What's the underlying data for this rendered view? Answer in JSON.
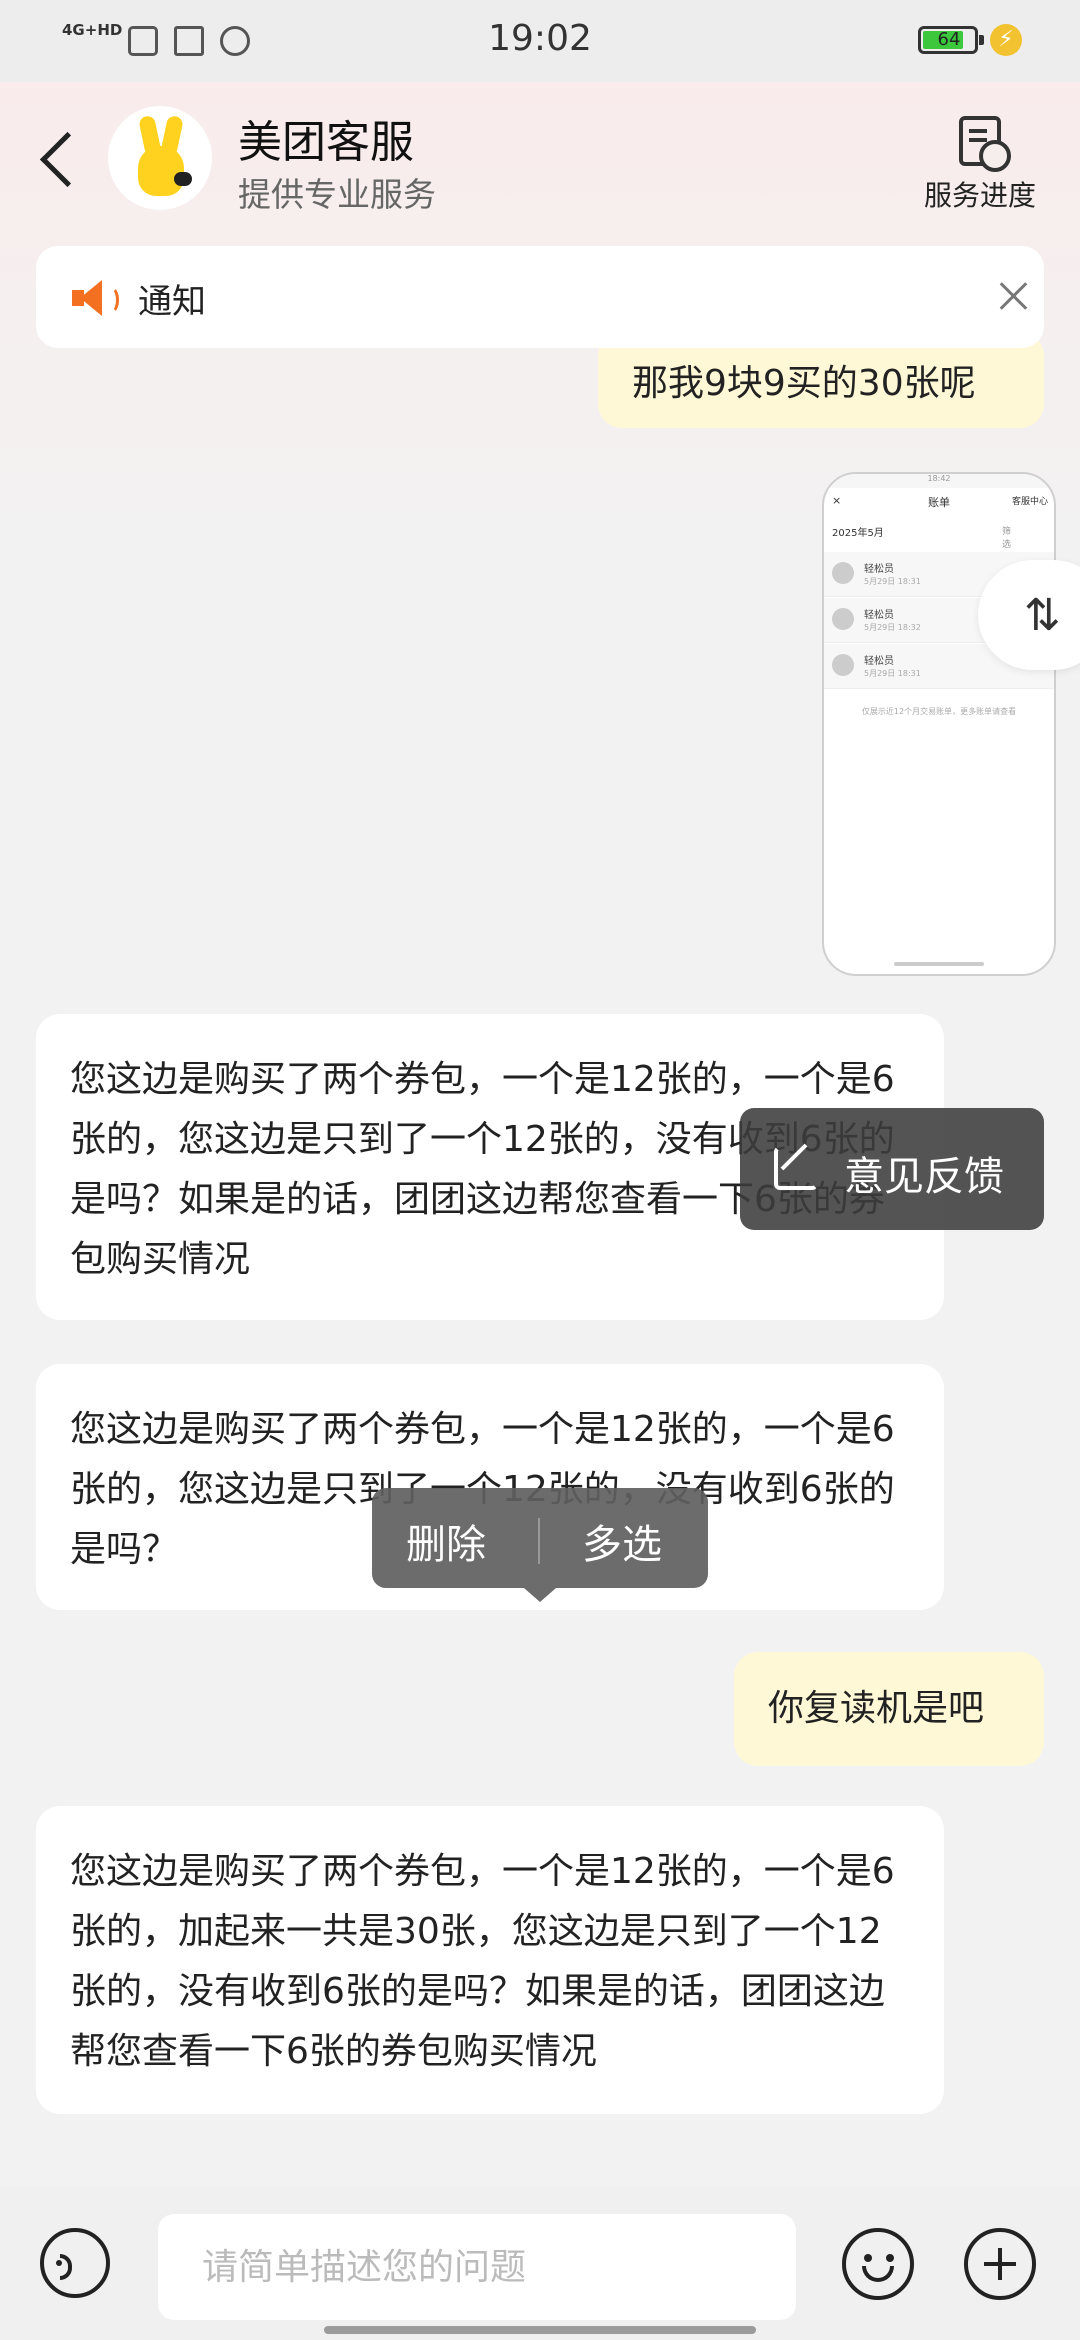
{
  "status_bar": {
    "network": "4G+HD",
    "time": "19:02",
    "battery": "64",
    "icons": [
      "sim-icon",
      "book-icon",
      "wechat-icon",
      "charging-icon"
    ]
  },
  "header": {
    "title": "美团客服",
    "subtitle": "提供专业服务",
    "progress_label": "服务进度"
  },
  "notice": {
    "label": "通知"
  },
  "messages": [
    {
      "role": "user",
      "text": "那我9块9买的30张呢"
    },
    {
      "role": "agent",
      "text": "您这边是购买了两个券包，一个是12张的，一个是6张的，您这边是只到了一个12张的，没有收到6张的是吗？如果是的话，团团这边帮您查看一下6张的券包购买情况"
    },
    {
      "role": "agent",
      "text": "您这边是购买了两个券包，一个是12张的，一个是6张的，您这边是只到了一个12张的，没有收到6张的是吗？"
    },
    {
      "role": "user",
      "text": "你复读机是吧"
    },
    {
      "role": "agent",
      "text": "您这边是购买了两个券包，一个是12张的，一个是6张的，加起来一共是30张，您这边是只到了一个12张的，没有收到6张的是吗？如果是的话，团团这边帮您查看一下6张的券包购买情况"
    }
  ],
  "screenshot_thumb": {
    "status_time": "18:42",
    "title": "账单",
    "close": "×",
    "right_link": "客服中心",
    "month": "2025年5月",
    "right_filter": "筛选",
    "rows": [
      {
        "name": "轻松员",
        "date": "5月29日 18:31"
      },
      {
        "name": "轻松员",
        "date": "5月29日 18:32"
      },
      {
        "name": "轻松员",
        "date": "5月29日 18:31"
      }
    ],
    "footer": "仅展示近12个月交易账单，更多账单请查看"
  },
  "floating": {
    "scroll_glyph": "⇅"
  },
  "feedback_popup": {
    "label": "意见反馈"
  },
  "context_menu": {
    "delete": "删除",
    "multi_select": "多选"
  },
  "input": {
    "placeholder": "请简单描述您的问题",
    "value": ""
  }
}
